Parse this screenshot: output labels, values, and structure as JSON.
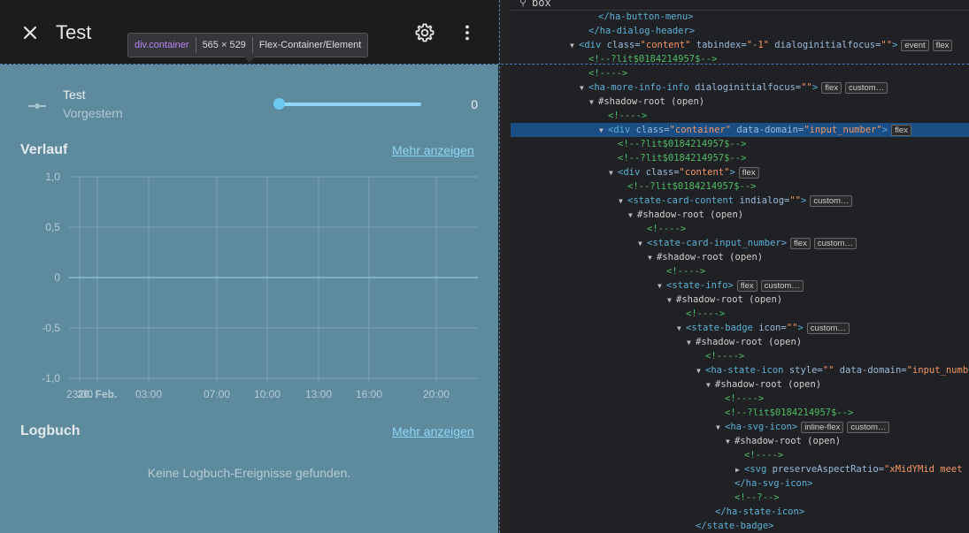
{
  "dialog": {
    "title": "Test",
    "close_icon": "close-icon",
    "settings_icon": "gear-icon",
    "menu_icon": "dots-vertical-icon"
  },
  "inspector": {
    "element": "div.container",
    "size": "565 × 529",
    "kind": "Flex-Container/Element"
  },
  "entity": {
    "name": "Test",
    "time": "Vorgestern",
    "value": "0",
    "slider_fraction": 0
  },
  "history": {
    "title": "Verlauf",
    "more_label": "Mehr anzeigen"
  },
  "logbook": {
    "title": "Logbuch",
    "more_label": "Mehr anzeigen",
    "empty": "Keine Logbuch-Ereignisse gefunden."
  },
  "chart_data": {
    "type": "line",
    "ylim": [
      -1.0,
      1.0
    ],
    "yticks": [
      "1,0",
      "0,5",
      "0",
      "-0,5",
      "-1,0"
    ],
    "xticks": [
      "23:00",
      "20. Feb.",
      "03:00",
      "07:00",
      "10:00",
      "13:00",
      "16:00",
      "20:00"
    ],
    "grid": true,
    "series": [
      {
        "values": [
          0,
          0
        ]
      }
    ],
    "line_color": "#7fb0c7"
  },
  "devtools": {
    "search": "box",
    "lines": [
      {
        "i": 10,
        "t": "none",
        "parts": [
          [
            "tag",
            "</ha-button-menu>"
          ]
        ]
      },
      {
        "i": 9,
        "t": "none",
        "parts": [
          [
            "tag",
            "</ha-dialog-header>"
          ]
        ]
      },
      {
        "i": 8,
        "t": "down",
        "parts": [
          [
            "tag",
            "<div "
          ],
          [
            "attr",
            "class="
          ],
          [
            "val",
            "\"content\""
          ],
          [
            "attr",
            " tabindex="
          ],
          [
            "val",
            "\"-1\""
          ],
          [
            "attr",
            " dialoginitialfocus="
          ],
          [
            "val",
            "\"\""
          ],
          [
            "tag",
            ">"
          ]
        ],
        "badges": [
          "event",
          "flex"
        ]
      },
      {
        "i": 9,
        "t": "none",
        "parts": [
          [
            "cmt",
            "<!--?lit$0184214957$-->"
          ]
        ]
      },
      {
        "i": 9,
        "t": "none",
        "parts": [
          [
            "cmt",
            "<!---->"
          ]
        ]
      },
      {
        "i": 9,
        "t": "down",
        "parts": [
          [
            "tag",
            "<ha-more-info-info "
          ],
          [
            "attr",
            "dialoginitialfocus="
          ],
          [
            "val",
            "\"\""
          ],
          [
            "tag",
            ">"
          ]
        ],
        "badges": [
          "flex",
          "custom…"
        ]
      },
      {
        "i": 10,
        "t": "down",
        "parts": [
          [
            "sr",
            "#shadow-root (open)"
          ]
        ]
      },
      {
        "i": 11,
        "t": "none",
        "parts": [
          [
            "cmt",
            "<!---->"
          ]
        ]
      },
      {
        "i": 11,
        "t": "down",
        "sel": true,
        "parts": [
          [
            "tag",
            "<div "
          ],
          [
            "attr",
            "class="
          ],
          [
            "val",
            "\"container\""
          ],
          [
            "attr",
            " data-domain="
          ],
          [
            "val",
            "\"input_number\""
          ],
          [
            "tag",
            ">"
          ]
        ],
        "badges": [
          "flex"
        ]
      },
      {
        "i": 12,
        "t": "none",
        "parts": [
          [
            "cmt",
            "<!--?lit$0184214957$-->"
          ]
        ]
      },
      {
        "i": 12,
        "t": "none",
        "parts": [
          [
            "cmt",
            "<!--?lit$0184214957$-->"
          ]
        ]
      },
      {
        "i": 12,
        "t": "down",
        "parts": [
          [
            "tag",
            "<div "
          ],
          [
            "attr",
            "class="
          ],
          [
            "val",
            "\"content\""
          ],
          [
            "tag",
            ">"
          ]
        ],
        "badges": [
          "flex"
        ]
      },
      {
        "i": 13,
        "t": "none",
        "parts": [
          [
            "cmt",
            "<!--?lit$0184214957$-->"
          ]
        ]
      },
      {
        "i": 13,
        "t": "down",
        "parts": [
          [
            "tag",
            "<state-card-content "
          ],
          [
            "attr",
            "indialog="
          ],
          [
            "val",
            "\"\""
          ],
          [
            "tag",
            ">"
          ]
        ],
        "badges": [
          "custom…"
        ]
      },
      {
        "i": 14,
        "t": "down",
        "parts": [
          [
            "sr",
            "#shadow-root (open)"
          ]
        ]
      },
      {
        "i": 15,
        "t": "none",
        "parts": [
          [
            "cmt",
            "<!---->"
          ]
        ]
      },
      {
        "i": 15,
        "t": "down",
        "parts": [
          [
            "tag",
            "<state-card-input_number>"
          ]
        ],
        "badges": [
          "flex",
          "custom…"
        ]
      },
      {
        "i": 16,
        "t": "down",
        "parts": [
          [
            "sr",
            "#shadow-root (open)"
          ]
        ]
      },
      {
        "i": 17,
        "t": "none",
        "parts": [
          [
            "cmt",
            "<!---->"
          ]
        ]
      },
      {
        "i": 17,
        "t": "down",
        "parts": [
          [
            "tag",
            "<state-info>"
          ]
        ],
        "badges": [
          "flex",
          "custom…"
        ]
      },
      {
        "i": 18,
        "t": "down",
        "parts": [
          [
            "sr",
            "#shadow-root (open)"
          ]
        ]
      },
      {
        "i": 19,
        "t": "none",
        "parts": [
          [
            "cmt",
            "<!---->"
          ]
        ]
      },
      {
        "i": 19,
        "t": "down",
        "parts": [
          [
            "tag",
            "<state-badge "
          ],
          [
            "attr",
            "icon="
          ],
          [
            "val",
            "\"\""
          ],
          [
            "tag",
            ">"
          ]
        ],
        "badges": [
          "custom…"
        ]
      },
      {
        "i": 20,
        "t": "down",
        "parts": [
          [
            "sr",
            "#shadow-root (open)"
          ]
        ]
      },
      {
        "i": 21,
        "t": "none",
        "parts": [
          [
            "cmt",
            "<!---->"
          ]
        ]
      },
      {
        "i": 21,
        "t": "down",
        "parts": [
          [
            "tag",
            "<ha-state-icon "
          ],
          [
            "attr",
            "style="
          ],
          [
            "val",
            "\"\""
          ],
          [
            "attr",
            " data-domain="
          ],
          [
            "val",
            "\"input_numb"
          ]
        ]
      },
      {
        "i": 22,
        "t": "down",
        "parts": [
          [
            "sr",
            "#shadow-root (open)"
          ]
        ]
      },
      {
        "i": 23,
        "t": "none",
        "parts": [
          [
            "cmt",
            "<!---->"
          ]
        ]
      },
      {
        "i": 23,
        "t": "none",
        "parts": [
          [
            "cmt",
            "<!--?lit$0184214957$-->"
          ]
        ]
      },
      {
        "i": 23,
        "t": "down",
        "parts": [
          [
            "tag",
            "<ha-svg-icon>"
          ]
        ],
        "badges": [
          "inline-flex",
          "custom…"
        ]
      },
      {
        "i": 24,
        "t": "down",
        "parts": [
          [
            "sr",
            "#shadow-root (open)"
          ]
        ]
      },
      {
        "i": 25,
        "t": "none",
        "parts": [
          [
            "cmt",
            "<!---->"
          ]
        ]
      },
      {
        "i": 25,
        "t": "right",
        "parts": [
          [
            "tag",
            "<svg "
          ],
          [
            "attr",
            "preserveAspectRatio="
          ],
          [
            "val",
            "\"xMidYMid meet"
          ]
        ]
      },
      {
        "i": 24,
        "t": "none",
        "parts": [
          [
            "tag",
            "</ha-svg-icon>"
          ]
        ]
      },
      {
        "i": 24,
        "t": "none",
        "parts": [
          [
            "cmt",
            "<!--?-->"
          ]
        ]
      },
      {
        "i": 22,
        "t": "none",
        "parts": [
          [
            "tag",
            "</ha-state-icon>"
          ]
        ]
      },
      {
        "i": 20,
        "t": "none",
        "parts": [
          [
            "tag",
            "</state-badge>"
          ]
        ]
      }
    ]
  }
}
